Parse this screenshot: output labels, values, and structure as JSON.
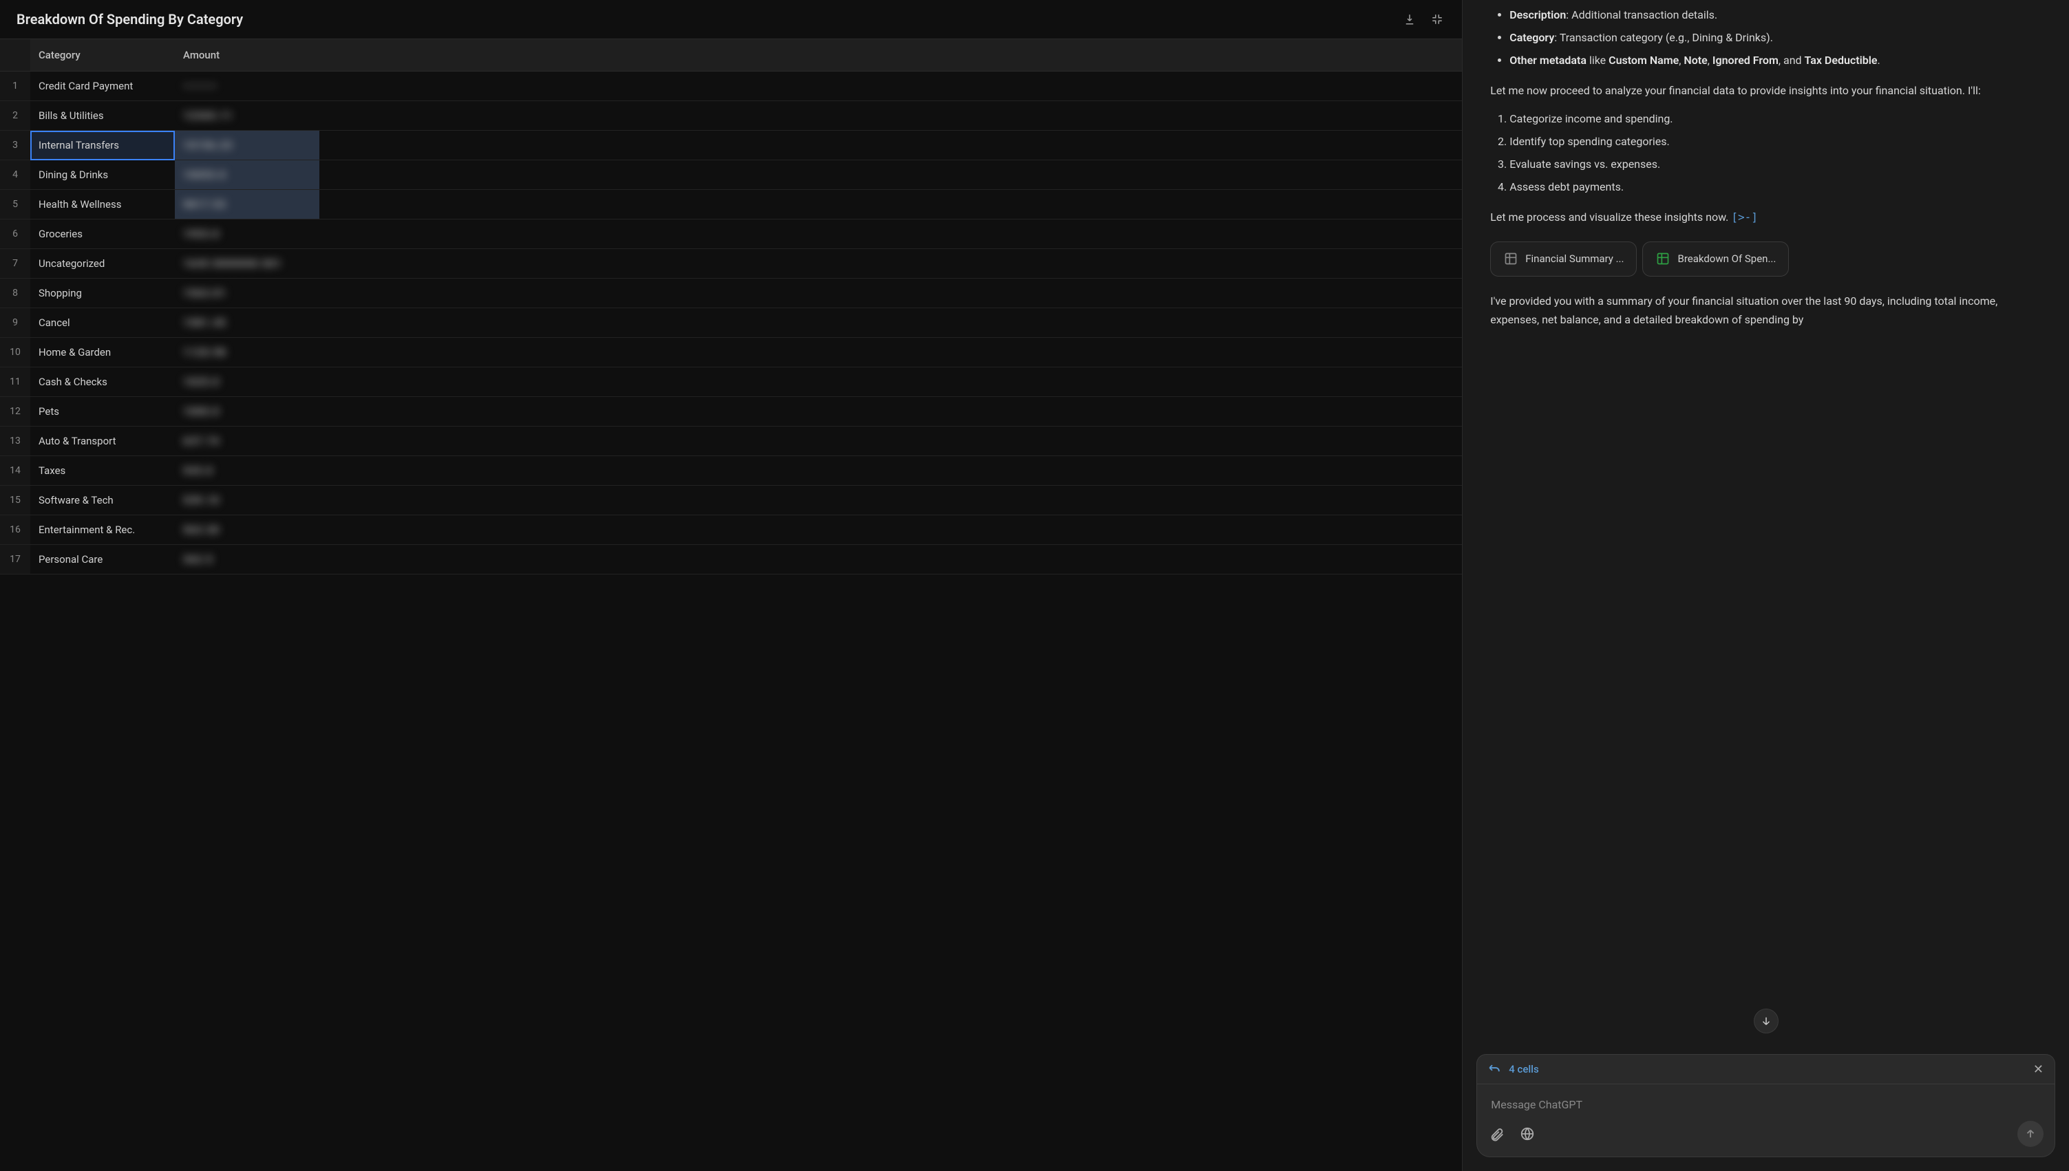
{
  "panel": {
    "title": "Breakdown Of Spending By Category",
    "columns": [
      "",
      "Category",
      "Amount",
      ""
    ],
    "rows": [
      {
        "n": "1",
        "category": "Credit Card Payment",
        "amount": "————"
      },
      {
        "n": "2",
        "category": "Bills & Utilities",
        "amount": "12365.11"
      },
      {
        "n": "3",
        "category": "Internal Transfers",
        "amount": "10156.23"
      },
      {
        "n": "4",
        "category": "Dining & Drinks",
        "amount": "10053.0"
      },
      {
        "n": "5",
        "category": "Health & Wellness",
        "amount": "9817.53"
      },
      {
        "n": "6",
        "category": "Groceries",
        "amount": "1953.0"
      },
      {
        "n": "7",
        "category": "Uncategorized",
        "amount": "1645 0000000 001"
      },
      {
        "n": "8",
        "category": "Shopping",
        "amount": "1563.01"
      },
      {
        "n": "9",
        "category": "Cancel",
        "amount": "1581.45"
      },
      {
        "n": "10",
        "category": "Home & Garden",
        "amount": "1120.98"
      },
      {
        "n": "11",
        "category": "Cash & Checks",
        "amount": "1025.0"
      },
      {
        "n": "12",
        "category": "Pets",
        "amount": "1000.0"
      },
      {
        "n": "13",
        "category": "Auto & Transport",
        "amount": "637.74"
      },
      {
        "n": "14",
        "category": "Taxes",
        "amount": "543.0"
      },
      {
        "n": "15",
        "category": "Software & Tech",
        "amount": "539.10"
      },
      {
        "n": "16",
        "category": "Entertainment & Rec.",
        "amount": "563.30"
      },
      {
        "n": "17",
        "category": "Personal Care",
        "amount": "362.5"
      }
    ]
  },
  "chat": {
    "bullets_meta": [
      {
        "bold": "Description",
        "rest": ": Additional transaction details."
      },
      {
        "bold": "Category",
        "rest": ": Transaction category (e.g., Dining & Drinks)."
      }
    ],
    "meta_line_parts": {
      "p1": "Other metadata",
      "p2": " like ",
      "p3": "Custom Name",
      "p4": ", ",
      "p5": "Note",
      "p6": ", ",
      "p7": "Ignored From",
      "p8": ", and ",
      "p9": "Tax Deductible",
      "p10": "."
    },
    "para1": "Let me now proceed to analyze your financial data to provide insights into your financial situation. I'll:",
    "steps": [
      "Categorize income and spending.",
      "Identify top spending categories.",
      "Evaluate savings vs. expenses.",
      "Assess debt payments."
    ],
    "para2": "Let me process and visualize these insights now.",
    "code_link": "[>-]",
    "chips": [
      {
        "label": "Financial Summary ...",
        "color": "#888"
      },
      {
        "label": "Breakdown Of Spen...",
        "color": "#2ea043"
      }
    ],
    "para3": "I've provided you with a summary of your financial situation over the last 90 days, including total income, expenses, net balance, and a detailed breakdown of spending by"
  },
  "input": {
    "context_label": "4 cells",
    "placeholder": "Message ChatGPT"
  }
}
